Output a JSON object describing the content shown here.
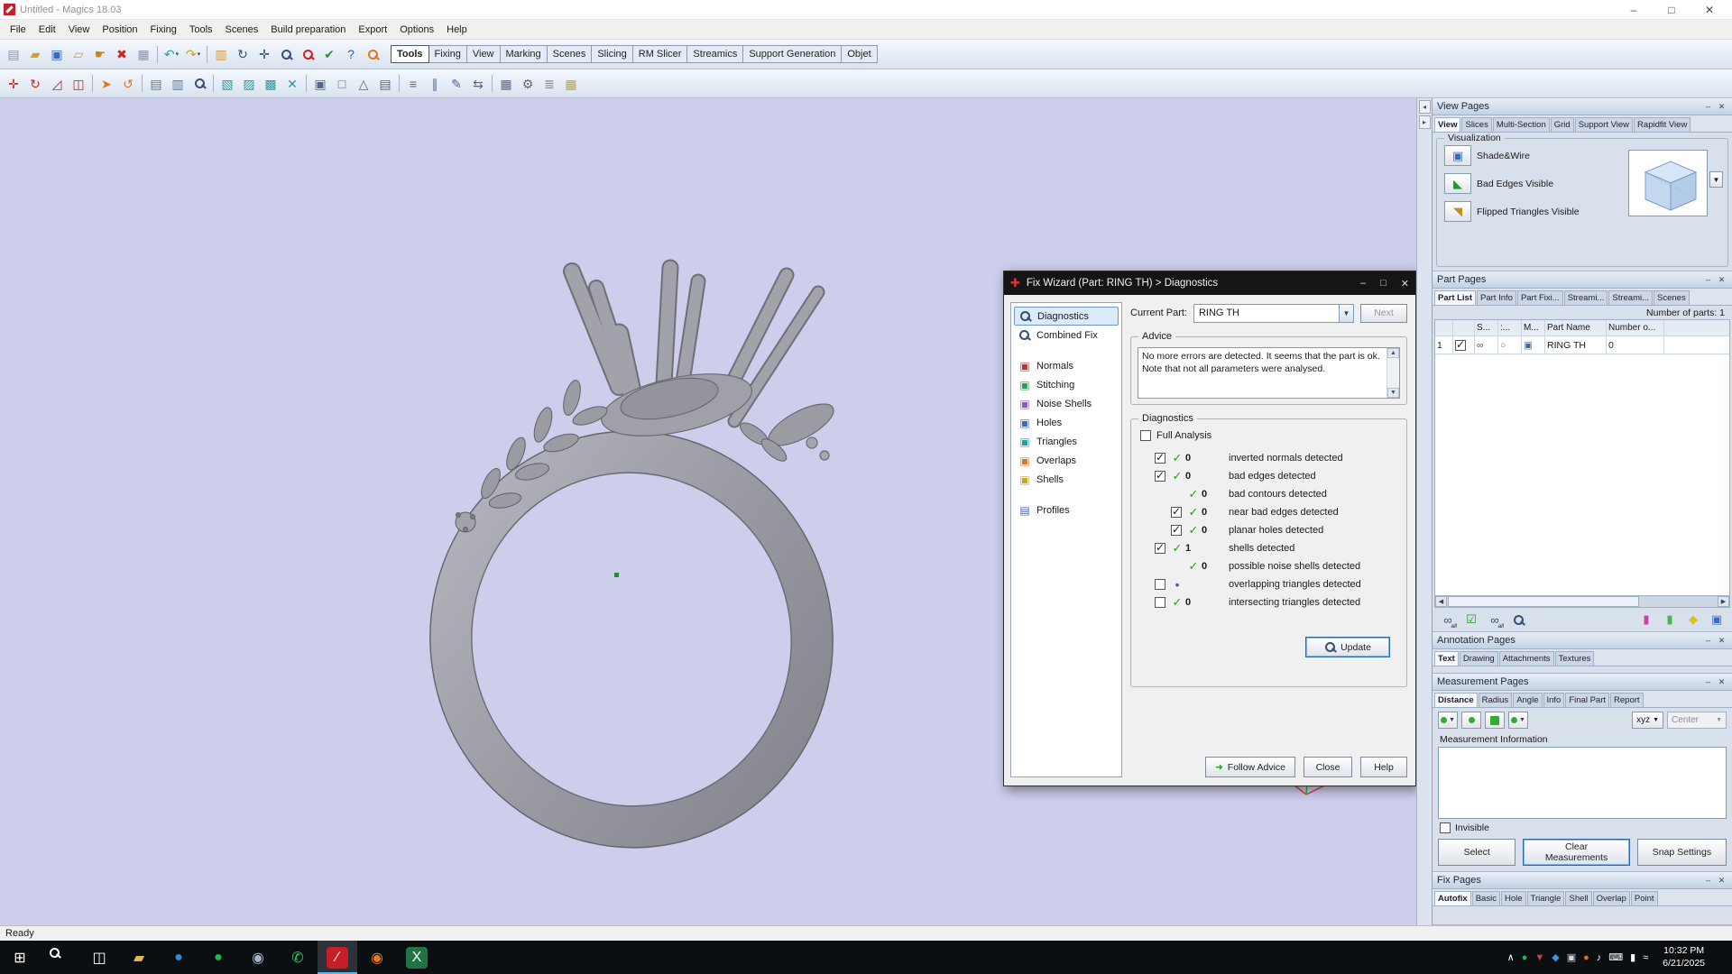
{
  "colors": {
    "viewport_bg": "#cdcdec",
    "magics_red": "#c81e28",
    "check_green": "#1e9e1e",
    "accent_blue": "#2a6bb0"
  },
  "titlebar": {
    "title": "Untitled - Magics 18.03",
    "minimize": "–",
    "maximize": "□",
    "close": "✕"
  },
  "menubar": {
    "items": [
      "File",
      "Edit",
      "View",
      "Position",
      "Fixing",
      "Tools",
      "Scenes",
      "Build preparation",
      "Export",
      "Options",
      "Help"
    ]
  },
  "ribbon": {
    "tabs": [
      {
        "label": "Tools",
        "active": true
      },
      {
        "label": "Fixing"
      },
      {
        "label": "View"
      },
      {
        "label": "Marking"
      },
      {
        "label": "Scenes"
      },
      {
        "label": "Slicing"
      },
      {
        "label": "RM Slicer"
      },
      {
        "label": "Streamics"
      },
      {
        "label": "Support Generation"
      },
      {
        "label": "Objet"
      }
    ]
  },
  "toolbar_main": {
    "icons": [
      {
        "name": "new-part-icon",
        "glyph": "▤",
        "color": "#8a94a6"
      },
      {
        "name": "open-file-icon",
        "glyph": "▰",
        "color": "#d89a33"
      },
      {
        "name": "save-icon",
        "glyph": "▣",
        "color": "#3a6abf"
      },
      {
        "name": "import-part-icon",
        "glyph": "▱",
        "color": "#d89a33"
      },
      {
        "name": "pick-part-icon",
        "glyph": "☛",
        "color": "#c98422"
      },
      {
        "name": "remove-part-icon",
        "glyph": "✖",
        "color": "#cc2222"
      },
      {
        "name": "print-icon",
        "glyph": "▦",
        "color": "#8a94a6"
      },
      {
        "sep": true
      },
      {
        "name": "undo-icon",
        "glyph": "↶",
        "color": "#2aa0a0",
        "dd": true
      },
      {
        "name": "redo-icon",
        "glyph": "↷",
        "color": "#caa21e",
        "dd": true
      },
      {
        "sep": true
      },
      {
        "name": "recent-files-icon",
        "glyph": "▥",
        "color": "#d89a33"
      },
      {
        "name": "rotate-view-icon",
        "glyph": "↻",
        "color": "#33507a"
      },
      {
        "name": "pan-view-icon",
        "glyph": "✛",
        "color": "#33507a"
      },
      {
        "name": "zoom-view-icon",
        "mag": true,
        "color": "#33507a"
      },
      {
        "name": "zoom-out-icon",
        "mag": true,
        "color": "#cc2222"
      },
      {
        "name": "confirm-icon",
        "glyph": "✔",
        "color": "#1e9e1e"
      },
      {
        "name": "help-icon",
        "glyph": "?",
        "color": "#2a62c8"
      },
      {
        "name": "find-part-icon",
        "mag": true,
        "color": "#d87a22"
      }
    ]
  },
  "toolbar_tools": {
    "icons": [
      {
        "name": "translate-part-icon",
        "glyph": "✛",
        "color": "#cc2222"
      },
      {
        "name": "rotate-part-icon",
        "glyph": "↻",
        "color": "#cc2222"
      },
      {
        "name": "rescale-part-icon",
        "glyph": "◿",
        "color": "#cc2222"
      },
      {
        "name": "mirror-part-icon",
        "glyph": "◫",
        "color": "#cc2222"
      },
      {
        "sep": true
      },
      {
        "name": "cursor-icon",
        "glyph": "➤",
        "color": "#d87a22"
      },
      {
        "name": "orbit-icon",
        "glyph": "↺",
        "color": "#d87a22"
      },
      {
        "sep": true
      },
      {
        "name": "copy-part-icon",
        "glyph": "▤",
        "color": "#5577aa"
      },
      {
        "name": "duplicate-part-icon",
        "glyph": "▥",
        "color": "#5577aa"
      },
      {
        "name": "zoom-box-icon",
        "mag": true,
        "color": "#33507a"
      },
      {
        "sep": true
      },
      {
        "name": "cube-shade-icon",
        "glyph": "▧",
        "color": "#2a9a9a"
      },
      {
        "name": "cube-wire-icon",
        "glyph": "▨",
        "color": "#2a9a9a"
      },
      {
        "name": "cube-points-icon",
        "glyph": "▩",
        "color": "#2a9a9a"
      },
      {
        "name": "cube-remove-icon",
        "glyph": "✕",
        "color": "#2a9a9a"
      },
      {
        "sep": true
      },
      {
        "name": "shade-mode-icon",
        "glyph": "▣",
        "color": "#556688"
      },
      {
        "name": "wire-mode-icon",
        "glyph": "□",
        "color": "#556688"
      },
      {
        "name": "triangle-mode-icon",
        "glyph": "△",
        "color": "#556688"
      },
      {
        "name": "section-mode-icon",
        "glyph": "▤",
        "color": "#556688"
      },
      {
        "sep": true
      },
      {
        "name": "slice-icon",
        "glyph": "≡",
        "color": "#556688"
      },
      {
        "name": "measure-icon",
        "glyph": "∥",
        "color": "#556688"
      },
      {
        "name": "annotate-icon",
        "glyph": "✎",
        "color": "#556688"
      },
      {
        "name": "compare-icon",
        "glyph": "⇆",
        "color": "#556688"
      },
      {
        "sep": true
      },
      {
        "name": "machine-icon",
        "glyph": "▦",
        "color": "#556688"
      },
      {
        "name": "settings-icon",
        "glyph": "⚙",
        "color": "#666666"
      },
      {
        "name": "hatch-icon",
        "glyph": "≣",
        "color": "#888888"
      },
      {
        "name": "support-icon",
        "glyph": "▦",
        "color": "#c9a22a"
      }
    ]
  },
  "fix_wizard": {
    "title": "Fix Wizard (Part: RING TH) > Diagnostics",
    "current_part_label": "Current Part:",
    "current_part_value": "RING TH",
    "next_button": "Next",
    "sidebar": [
      {
        "label": "Diagnostics",
        "selected": true,
        "mag": true,
        "color": "#33507a"
      },
      {
        "label": "Combined Fix",
        "mag": true,
        "color": "#33507a"
      },
      {
        "label": "Normals",
        "glyph": "▣",
        "color": "#b03a3a",
        "gap": true
      },
      {
        "label": "Stitching",
        "glyph": "▣",
        "color": "#2f9e50"
      },
      {
        "label": "Noise Shells",
        "glyph": "▣",
        "color": "#8a5ac0"
      },
      {
        "label": "Holes",
        "glyph": "▣",
        "color": "#3a6abf"
      },
      {
        "label": "Triangles",
        "glyph": "▣",
        "color": "#2a9a9a"
      },
      {
        "label": "Overlaps",
        "glyph": "▣",
        "color": "#d87a22"
      },
      {
        "label": "Shells",
        "glyph": "▣",
        "color": "#c9a22a"
      },
      {
        "label": "Profiles",
        "glyph": "▤",
        "color": "#3a6abf",
        "gap": true
      }
    ],
    "advice": {
      "title": "Advice",
      "text": "No more errors are detected. It seems that the part is ok. Note that not all parameters were analysed."
    },
    "diagnostics": {
      "title": "Diagnostics",
      "full_analysis_label": "Full Analysis",
      "rows": [
        {
          "has_checkbox": true,
          "checked": true,
          "status_glyph": "✓",
          "status_color": "#1e9e1e",
          "count": "0",
          "label": "inverted normals detected"
        },
        {
          "has_checkbox": true,
          "checked": true,
          "status_glyph": "✓",
          "status_color": "#1e9e1e",
          "count": "0",
          "label": "bad edges detected"
        },
        {
          "has_checkbox": false,
          "indent": true,
          "status_glyph": "✓",
          "status_color": "#1e9e1e",
          "count": "0",
          "label": "bad contours detected"
        },
        {
          "has_checkbox": true,
          "checked": true,
          "indent": true,
          "status_glyph": "✓",
          "status_color": "#1e9e1e",
          "count": "0",
          "label": "near bad edges detected"
        },
        {
          "has_checkbox": true,
          "checked": true,
          "indent": true,
          "status_glyph": "✓",
          "status_color": "#1e9e1e",
          "count": "0",
          "label": "planar holes detected"
        },
        {
          "has_checkbox": true,
          "checked": true,
          "status_glyph": "✓",
          "status_color": "#1e9e1e",
          "count": "1",
          "label": "shells detected"
        },
        {
          "has_checkbox": false,
          "indent": true,
          "status_glyph": "✓",
          "status_color": "#1e9e1e",
          "count": "0",
          "label": "possible noise shells detected"
        },
        {
          "has_checkbox": true,
          "checked": false,
          "status_glyph": "•",
          "status_color": "#3a55cc",
          "count": "",
          "label": "overlapping triangles detected"
        },
        {
          "has_checkbox": true,
          "checked": false,
          "status_glyph": "✓",
          "status_color": "#1e9e1e",
          "count": "0",
          "label": "intersecting triangles detected"
        }
      ],
      "update_button": "Update"
    },
    "footer": {
      "follow_advice": "Follow Advice",
      "close": "Close",
      "help": "Help"
    }
  },
  "panels": {
    "view_pages": {
      "title": "View Pages",
      "tabs": [
        {
          "label": "View",
          "active": true
        },
        {
          "label": "Slices"
        },
        {
          "label": "Multi-Section"
        },
        {
          "label": "Grid"
        },
        {
          "label": "Support View"
        },
        {
          "label": "Rapidfit View"
        }
      ],
      "group_title": "Visualization",
      "options": [
        {
          "name": "shade-wire-button",
          "glyph": "▣",
          "color": "#3a6abf",
          "label": "Shade&Wire"
        },
        {
          "name": "bad-edges-button",
          "glyph": "◣",
          "color": "#1e9e1e",
          "label": "Bad Edges Visible"
        },
        {
          "name": "flipped-triangles-button",
          "glyph": "◥",
          "color": "#c98a22",
          "label": "Flipped Triangles Visible"
        }
      ]
    },
    "part_pages": {
      "title": "Part Pages",
      "tabs": [
        {
          "label": "Part List",
          "active": true
        },
        {
          "label": "Part Info"
        },
        {
          "label": "Part Fixi..."
        },
        {
          "label": "Streami..."
        },
        {
          "label": "Streami..."
        },
        {
          "label": "Scenes"
        }
      ],
      "count_label": "Number of parts: 1",
      "columns": [
        "",
        "",
        "S...",
        ":...",
        "M...",
        "Part Name",
        "Number o...",
        ""
      ],
      "row": {
        "index": "1",
        "visible_glyph": "∞",
        "circle_glyph": "○",
        "cube_glyph": "▣",
        "name": "RING TH",
        "number": "0"
      },
      "footer_icons_left": [
        {
          "name": "show-all-parts-icon",
          "glyph": "∞",
          "color": "#33507a",
          "label": "all"
        },
        {
          "name": "select-parts-icon",
          "glyph": "☑",
          "color": "#1e9e1e"
        },
        {
          "name": "view-all-parts-icon",
          "glyph": "∞",
          "color": "#33507a",
          "label": "all"
        },
        {
          "name": "find-part-icon",
          "mag": true,
          "color": "#33507a"
        }
      ],
      "footer_icons_right": [
        {
          "name": "color-parts-icon",
          "glyph": "▮",
          "color": "#d040a0"
        },
        {
          "name": "status-parts-icon",
          "glyph": "▮",
          "color": "#4ab54a"
        },
        {
          "name": "tag-parts-icon",
          "glyph": "◆",
          "color": "#d8c020"
        },
        {
          "name": "platform-parts-icon",
          "glyph": "▣",
          "color": "#3a6abf"
        }
      ]
    },
    "annotation_pages": {
      "title": "Annotation Pages",
      "tabs": [
        {
          "label": "Text",
          "active": true
        },
        {
          "label": "Drawing"
        },
        {
          "label": "Attachments"
        },
        {
          "label": "Textures"
        }
      ]
    },
    "measurement_pages": {
      "title": "Measurement Pages",
      "tabs": [
        {
          "label": "Distance",
          "active": true
        },
        {
          "label": "Radius"
        },
        {
          "label": "Angle"
        },
        {
          "label": "Info"
        },
        {
          "label": "Final Part"
        },
        {
          "label": "Report"
        }
      ],
      "snap_controls": [
        {
          "name": "snap-point-combo",
          "dropdown": true
        },
        {
          "name": "snap-mode-button"
        },
        {
          "name": "snap-plane-toggle",
          "filled": true
        },
        {
          "name": "snap-circle-combo",
          "dropdown": true
        }
      ],
      "axis_button": "xyz",
      "mode_select": "Center",
      "info_label": "Measurement Information",
      "invisible_label": "Invisible",
      "buttons": {
        "select": "Select",
        "clear": "Clear Measurements",
        "snap": "Snap Settings"
      }
    },
    "fix_pages": {
      "title": "Fix Pages",
      "tabs": [
        {
          "label": "Autofix",
          "active": true
        },
        {
          "label": "Basic"
        },
        {
          "label": "Hole"
        },
        {
          "label": "Triangle"
        },
        {
          "label": "Shell"
        },
        {
          "label": "Overlap"
        },
        {
          "label": "Point"
        }
      ]
    }
  },
  "statusbar": {
    "text": "Ready"
  },
  "taskbar": {
    "apps": [
      {
        "name": "start-button",
        "glyph": "⊞",
        "color": "#ffffff"
      },
      {
        "name": "search-button",
        "mag": true,
        "color": "#ffffff"
      },
      {
        "name": "task-view-button",
        "glyph": "◫",
        "color": "#ffffff"
      },
      {
        "name": "file-explorer-icon",
        "glyph": "▰",
        "color": "#e8b64c"
      },
      {
        "name": "edge-icon",
        "glyph": "●",
        "color": "#2f8fd8"
      },
      {
        "name": "spotify-icon",
        "glyph": "●",
        "color": "#1db954"
      },
      {
        "name": "steam-icon",
        "glyph": "◉",
        "color": "#9fb6c8"
      },
      {
        "name": "whatsapp-icon",
        "glyph": "✆",
        "color": "#25d366"
      },
      {
        "name": "magics-icon",
        "glyph": "∕",
        "color": "#ffffff",
        "bg": "#c81e28",
        "active": true
      },
      {
        "name": "dark-app-icon",
        "glyph": "◉",
        "color": "#e87820"
      },
      {
        "name": "excel-icon",
        "glyph": "X",
        "color": "#ffffff",
        "bg": "#217346"
      }
    ],
    "tray": [
      {
        "name": "hidden-icons-chevron",
        "glyph": "∧",
        "color": "#ffffff"
      },
      {
        "name": "spotify-tray-icon",
        "glyph": "●",
        "color": "#1db954"
      },
      {
        "name": "update-tray-icon",
        "glyph": "▼",
        "color": "#d04040"
      },
      {
        "name": "bluetooth-tray-icon",
        "glyph": "◆",
        "color": "#4090e0"
      },
      {
        "name": "defender-tray-icon",
        "glyph": "▣",
        "color": "#cfd4da"
      },
      {
        "name": "alert-tray-icon",
        "glyph": "●",
        "color": "#e07020"
      },
      {
        "name": "volume-tray-icon",
        "glyph": "♪",
        "color": "#ffffff"
      },
      {
        "name": "keyboard-tray-icon",
        "glyph": "⌨",
        "color": "#ffffff"
      },
      {
        "name": "battery-tray-icon",
        "glyph": "▮",
        "color": "#ffffff"
      },
      {
        "name": "network-tray-icon",
        "glyph": "≈",
        "color": "#ffffff"
      }
    ],
    "clock": {
      "time": "10:32 PM",
      "date": "6/21/2025"
    }
  }
}
